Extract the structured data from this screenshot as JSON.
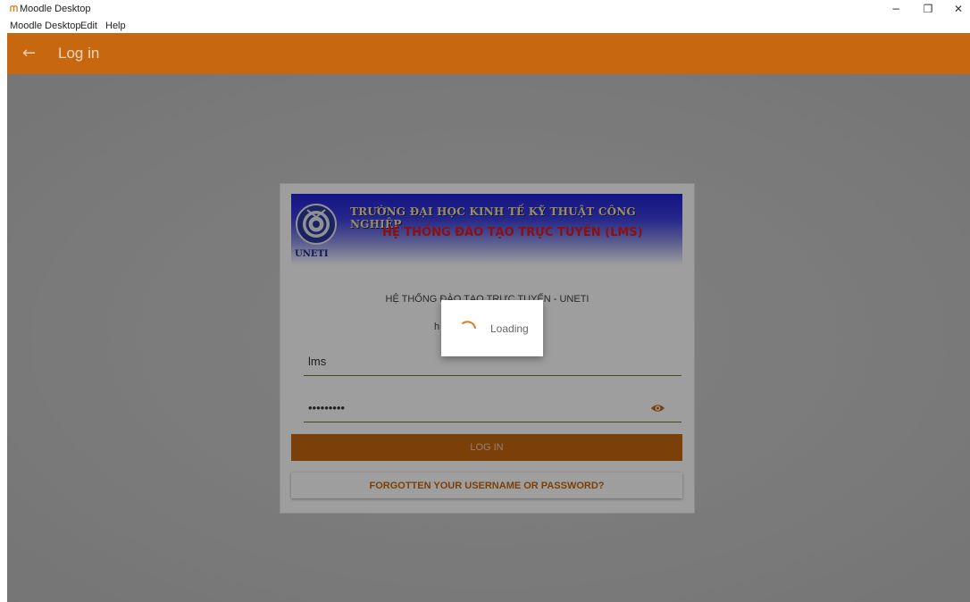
{
  "window": {
    "title": "Moodle Desktop",
    "controls": {
      "minimize": "−",
      "maximize": "❐",
      "close": "✕"
    }
  },
  "menu": [
    "Moodle Desktop",
    "Edit",
    "Help"
  ],
  "header": {
    "back_icon": "arrow-left-icon",
    "back_glyph": "←",
    "title": "Log in"
  },
  "banner": {
    "line1": "TRƯỜNG ĐẠI HỌC KINH TẾ KỸ THUẬT CÔNG NGHIỆP",
    "line2": "HỆ THỐNG ĐÀO TẠO TRỰC TUYẾN (LMS)",
    "logo_text": "UNETI"
  },
  "site": {
    "name": "HỆ THỐNG ĐÀO TẠO TRỰC TUYẾN - UNETI",
    "url_partial": "h"
  },
  "form": {
    "username": "lms",
    "password_masked": "•••••••••",
    "login_label": "LOG IN",
    "forgot_label": "FORGOTTEN YOUR USERNAME OR PASSWORD?"
  },
  "loading": {
    "text": "Loading"
  },
  "colors": {
    "accent": "#c7670f",
    "field_underline": "#6a7b2a",
    "banner_blue": "#1f22d6"
  }
}
